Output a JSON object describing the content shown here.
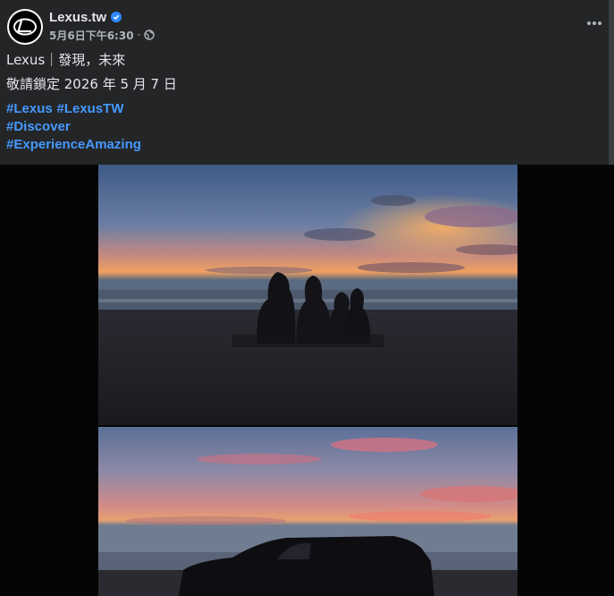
{
  "header": {
    "page_name": "Lexus.tw",
    "timestamp": "5月6日下午6:30",
    "separator": "·",
    "verified_icon": "verified-badge-icon",
    "audience_icon": "globe-icon",
    "more_icon": "more-options-icon"
  },
  "post": {
    "line1": "Lexus｜發現，未來",
    "line2": "敬請鎖定 2026 年 5 月 7 日",
    "hashtags_row1": [
      "#Lexus",
      "#LexusTW"
    ],
    "hashtags_row2": [
      "#Discover"
    ],
    "hashtags_row3": [
      "#ExperienceAmazing"
    ]
  },
  "colors": {
    "background": "#242526",
    "hashtag": "#4599ff",
    "verified": "#2d88ff",
    "media_background": "#050505"
  }
}
